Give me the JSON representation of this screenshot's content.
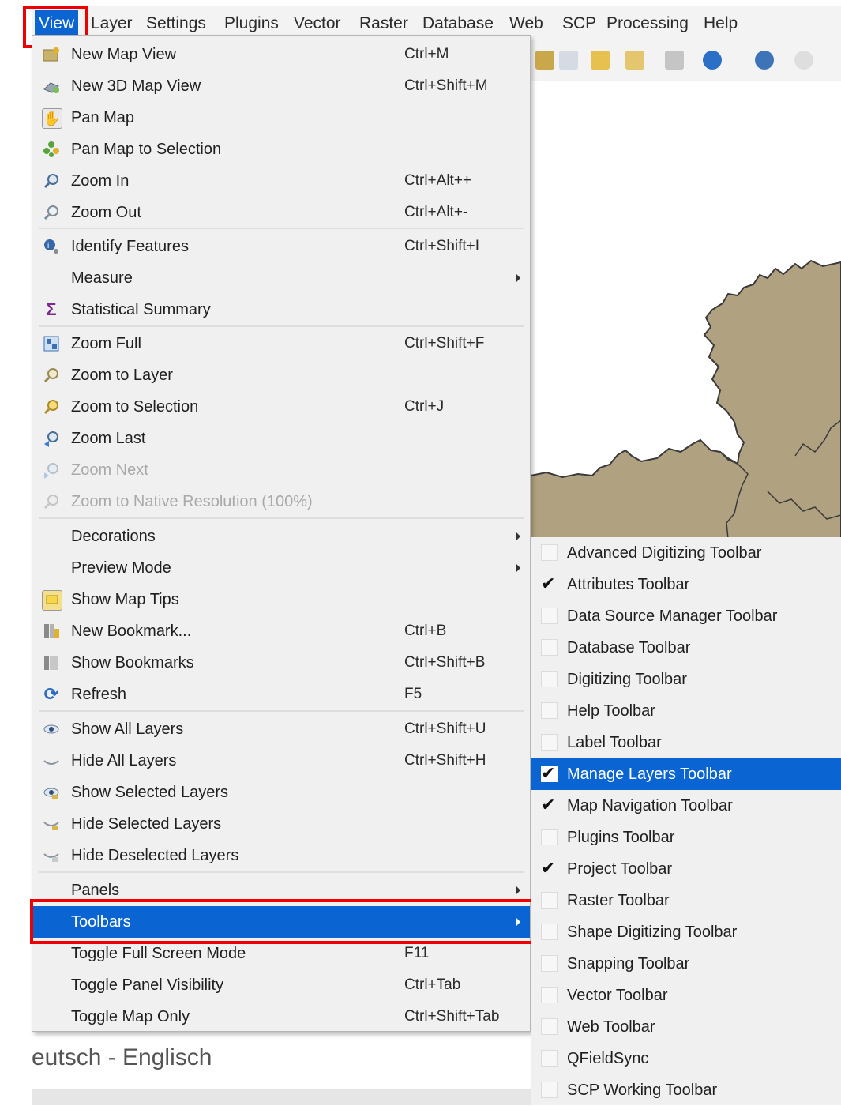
{
  "menubar": {
    "items": [
      "View",
      "Layer",
      "Settings",
      "Plugins",
      "Vector",
      "Raster",
      "Database",
      "Web",
      "SCP",
      "Processing",
      "Help"
    ],
    "active_index": 0
  },
  "view_menu": {
    "items": [
      {
        "label": "New Map View",
        "shortcut": "Ctrl+M",
        "icon": "new-map-view-icon"
      },
      {
        "label": "New 3D Map View",
        "shortcut": "Ctrl+Shift+M",
        "icon": "new-3d-map-view-icon"
      },
      {
        "label": "Pan Map",
        "shortcut": "",
        "icon": "pan-hand-icon"
      },
      {
        "label": "Pan Map to Selection",
        "shortcut": "",
        "icon": "pan-to-selection-icon"
      },
      {
        "label": "Zoom In",
        "shortcut": "Ctrl+Alt++",
        "icon": "zoom-in-icon"
      },
      {
        "label": "Zoom Out",
        "shortcut": "Ctrl+Alt+-",
        "icon": "zoom-out-icon"
      },
      {
        "label": "Identify Features",
        "shortcut": "Ctrl+Shift+I",
        "icon": "identify-icon"
      },
      {
        "label": "Measure",
        "shortcut": "",
        "icon": "",
        "submenu": true
      },
      {
        "label": "Statistical Summary",
        "shortcut": "",
        "icon": "sigma-icon"
      },
      {
        "label": "Zoom Full",
        "shortcut": "Ctrl+Shift+F",
        "icon": "zoom-full-icon"
      },
      {
        "label": "Zoom to Layer",
        "shortcut": "",
        "icon": "zoom-to-layer-icon"
      },
      {
        "label": "Zoom to Selection",
        "shortcut": "Ctrl+J",
        "icon": "zoom-to-selection-icon"
      },
      {
        "label": "Zoom Last",
        "shortcut": "",
        "icon": "zoom-last-icon"
      },
      {
        "label": "Zoom Next",
        "shortcut": "",
        "icon": "zoom-next-icon",
        "disabled": true
      },
      {
        "label": "Zoom to Native Resolution (100%)",
        "shortcut": "",
        "icon": "zoom-native-icon",
        "disabled": true
      },
      {
        "label": "Decorations",
        "shortcut": "",
        "icon": "",
        "submenu": true
      },
      {
        "label": "Preview Mode",
        "shortcut": "",
        "icon": "",
        "submenu": true
      },
      {
        "label": "Show Map Tips",
        "shortcut": "",
        "icon": "map-tips-icon"
      },
      {
        "label": "New Bookmark...",
        "shortcut": "Ctrl+B",
        "icon": "new-bookmark-icon"
      },
      {
        "label": "Show Bookmarks",
        "shortcut": "Ctrl+Shift+B",
        "icon": "show-bookmarks-icon"
      },
      {
        "label": "Refresh",
        "shortcut": "F5",
        "icon": "refresh-icon"
      },
      {
        "label": "Show All Layers",
        "shortcut": "Ctrl+Shift+U",
        "icon": "show-all-layers-icon"
      },
      {
        "label": "Hide All Layers",
        "shortcut": "Ctrl+Shift+H",
        "icon": "hide-all-layers-icon"
      },
      {
        "label": "Show Selected Layers",
        "shortcut": "",
        "icon": "show-selected-layers-icon"
      },
      {
        "label": "Hide Selected Layers",
        "shortcut": "",
        "icon": "hide-selected-layers-icon"
      },
      {
        "label": "Hide Deselected Layers",
        "shortcut": "",
        "icon": "hide-deselected-layers-icon"
      },
      {
        "label": "Panels",
        "shortcut": "",
        "icon": "",
        "submenu": true
      },
      {
        "label": "Toolbars",
        "shortcut": "",
        "icon": "",
        "submenu": true,
        "selected": true
      },
      {
        "label": "Toggle Full Screen Mode",
        "shortcut": "F11",
        "icon": ""
      },
      {
        "label": "Toggle Panel Visibility",
        "shortcut": "Ctrl+Tab",
        "icon": ""
      },
      {
        "label": "Toggle Map Only",
        "shortcut": "Ctrl+Shift+Tab",
        "icon": ""
      }
    ]
  },
  "toolbars_submenu": {
    "items": [
      {
        "label": "Advanced Digitizing Toolbar",
        "checked": false
      },
      {
        "label": "Attributes Toolbar",
        "checked": true
      },
      {
        "label": "Data Source Manager Toolbar",
        "checked": false
      },
      {
        "label": "Database Toolbar",
        "checked": false
      },
      {
        "label": "Digitizing Toolbar",
        "checked": false
      },
      {
        "label": "Help Toolbar",
        "checked": false
      },
      {
        "label": "Label Toolbar",
        "checked": false
      },
      {
        "label": "Manage Layers Toolbar",
        "checked": true,
        "selected": true
      },
      {
        "label": "Map Navigation Toolbar",
        "checked": true
      },
      {
        "label": "Plugins Toolbar",
        "checked": false
      },
      {
        "label": "Project Toolbar",
        "checked": true
      },
      {
        "label": "Raster Toolbar",
        "checked": false
      },
      {
        "label": "Shape Digitizing Toolbar",
        "checked": false
      },
      {
        "label": "Snapping Toolbar",
        "checked": false
      },
      {
        "label": "Vector Toolbar",
        "checked": false
      },
      {
        "label": "Web Toolbar",
        "checked": false
      },
      {
        "label": "QFieldSync",
        "checked": false
      },
      {
        "label": "SCP Working Toolbar",
        "checked": false
      }
    ]
  },
  "background": {
    "bottom_text": "eutsch - Englisch"
  },
  "colors": {
    "selection": "#0a64d2",
    "highlight_box": "#ee0000",
    "map_fill": "#b0a181"
  }
}
